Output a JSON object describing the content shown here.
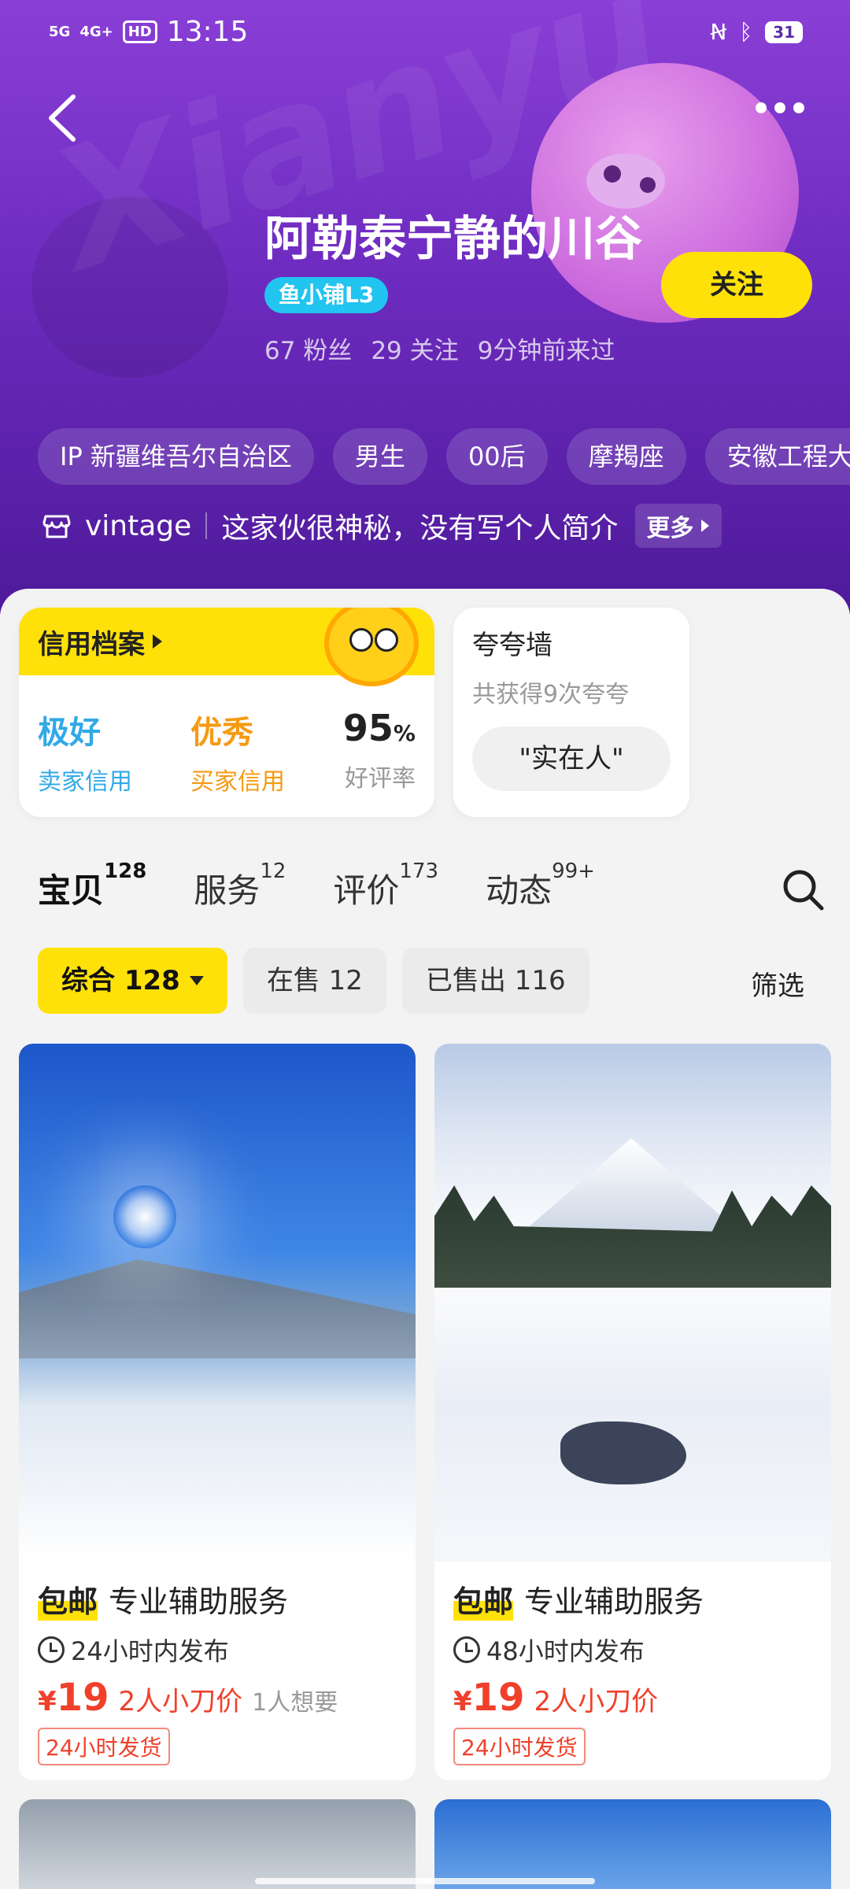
{
  "status_bar": {
    "network1": "5G",
    "network2": "4G+",
    "hd": "HD",
    "time": "13:15",
    "battery": "31"
  },
  "profile": {
    "name": "阿勒泰宁静的川谷",
    "level_badge": "鱼小铺L3",
    "follow_label": "关注",
    "stats": [
      "67 粉丝",
      "29 关注",
      "9分钟前来过"
    ],
    "tags": [
      "IP 新疆维吾尔自治区",
      "男生",
      "00后",
      "摩羯座",
      "安徽工程大学"
    ],
    "bio_brand": "vintage",
    "bio_text": "这家伙很神秘，没有写个人简介",
    "bio_more": "更多"
  },
  "credit": {
    "title": "信用档案",
    "seller_grade": "极好",
    "seller_label": "卖家信用",
    "buyer_grade": "优秀",
    "buyer_label": "买家信用",
    "rate_value": "95",
    "rate_unit": "%",
    "rate_label": "好评率"
  },
  "praise": {
    "title": "夸夸墙",
    "subtitle": "共获得9次夸夸",
    "pill": "\"实在人\""
  },
  "tabs": [
    {
      "label": "宝贝",
      "count": "128"
    },
    {
      "label": "服务",
      "count": "12"
    },
    {
      "label": "评价",
      "count": "173"
    },
    {
      "label": "动态",
      "count": "99+"
    }
  ],
  "filters": {
    "all": "综合 128",
    "on_sale": "在售 12",
    "sold": "已售出 116",
    "screen": "筛选"
  },
  "items": [
    {
      "badge": "包邮",
      "title": "专业辅助服务",
      "time": "24小时内发布",
      "currency": "¥",
      "price": "19",
      "bargain": "2人小刀价",
      "want": "1人想要",
      "ship": "24小时发货"
    },
    {
      "badge": "包邮",
      "title": "专业辅助服务",
      "time": "48小时内发布",
      "currency": "¥",
      "price": "19",
      "bargain": "2人小刀价",
      "ship": "24小时发货"
    }
  ],
  "colors": {
    "brand_yellow": "#ffe10a",
    "header_purple": "#6d2bbf",
    "price_red": "#f0402b"
  }
}
